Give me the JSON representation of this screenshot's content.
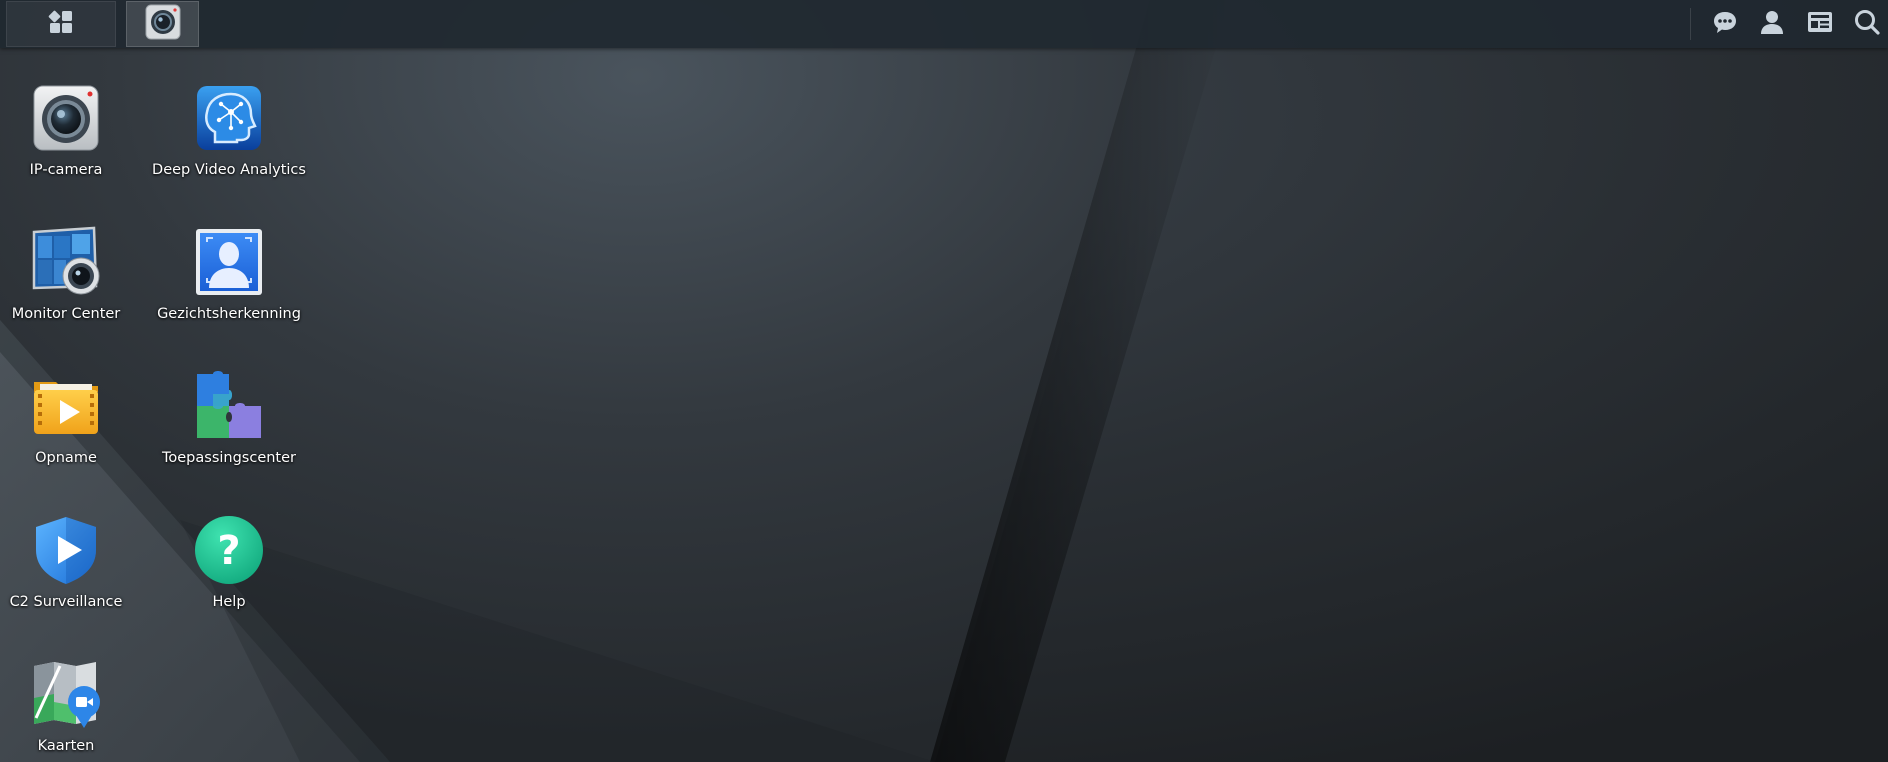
{
  "taskbar": {
    "main_menu_icon": "grid-icon",
    "open_app_icon": "ip-camera-icon",
    "tray": [
      {
        "name": "chat-icon"
      },
      {
        "name": "user-icon"
      },
      {
        "name": "widgets-icon"
      },
      {
        "name": "search-icon"
      }
    ]
  },
  "desktop": {
    "shortcuts": [
      {
        "label": "IP-camera",
        "icon": "ip-camera-icon"
      },
      {
        "label": "Deep Video Analytics",
        "icon": "deep-video-analytics-icon"
      },
      {
        "label": "Monitor Center",
        "icon": "monitor-center-icon"
      },
      {
        "label": "Gezichtsherkenning",
        "icon": "face-recognition-icon"
      },
      {
        "label": "Opname",
        "icon": "recording-folder-icon"
      },
      {
        "label": "Toepassingscenter",
        "icon": "puzzle-icon"
      },
      {
        "label": "C2 Surveillance",
        "icon": "c2-shield-icon"
      },
      {
        "label": "Help",
        "icon": "help-icon"
      },
      {
        "label": "Kaarten",
        "icon": "map-icon"
      }
    ]
  },
  "colors": {
    "taskbar_bg": "#202830",
    "desktop_bg": "#2b2f33",
    "tray_icon": "#c9d3dc"
  }
}
